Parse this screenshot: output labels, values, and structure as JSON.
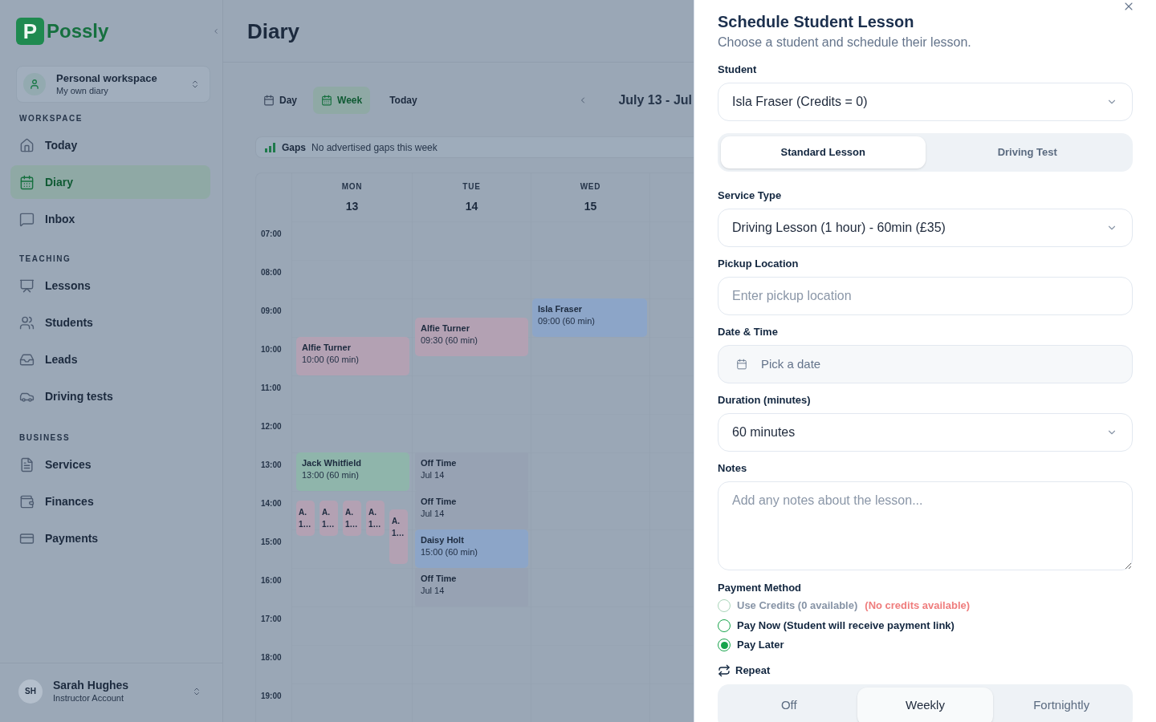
{
  "backdrop": {
    "sidebar": {
      "logo": {
        "mark": "P",
        "name": "Possly"
      },
      "workspace": {
        "title": "Personal workspace",
        "subtitle": "My own diary"
      },
      "sections": [
        {
          "title": "WORKSPACE",
          "items": [
            {
              "label": "Today",
              "selected": false
            },
            {
              "label": "Diary",
              "selected": true
            },
            {
              "label": "Inbox",
              "selected": false
            }
          ]
        },
        {
          "title": "TEACHING",
          "items": [
            {
              "label": "Lessons",
              "selected": false
            },
            {
              "label": "Students",
              "selected": false
            },
            {
              "label": "Leads",
              "selected": false
            },
            {
              "label": "Driving tests",
              "selected": false
            }
          ]
        },
        {
          "title": "BUSINESS",
          "items": [
            {
              "label": "Services",
              "selected": false
            },
            {
              "label": "Finances",
              "selected": false
            },
            {
              "label": "Payments",
              "selected": false
            }
          ]
        }
      ],
      "user": {
        "initials": "SH",
        "name": "Sarah Hughes",
        "role": "Instructor Account"
      }
    },
    "main": {
      "title": "Diary",
      "view_tabs": [
        {
          "label": "Day",
          "selected": false
        },
        {
          "label": "Week",
          "selected": true
        }
      ],
      "today_button": "Today",
      "date_range": "July 13 - Jul",
      "gaps": {
        "label": "Gaps",
        "text": "No advertised gaps this week"
      },
      "calendar": {
        "hours": [
          "07:00",
          "08:00",
          "09:00",
          "10:00",
          "11:00",
          "12:00",
          "13:00",
          "14:00",
          "15:00",
          "16:00",
          "17:00",
          "18:00",
          "19:00"
        ],
        "days": [
          {
            "weekday": "MON",
            "date": "13",
            "events": [
              {
                "kind": "lesson",
                "title": "Alfie Turner",
                "time": "10:00 (60 min)",
                "color": "#b3a1b3"
              },
              {
                "kind": "lesson",
                "title": "Jack Whitfield",
                "time": "13:00 (60 min)",
                "color": "#8fb5ab"
              },
              {
                "kind": "lesson",
                "title": "A.",
                "time": "1…",
                "color": "#b3a1b3"
              },
              {
                "kind": "lesson",
                "title": "A.",
                "time": "1…",
                "color": "#b3a1b3"
              },
              {
                "kind": "lesson",
                "title": "A.",
                "time": "1…",
                "color": "#b3a1b3"
              },
              {
                "kind": "lesson",
                "title": "A.",
                "time": "1…",
                "color": "#b3a1b3"
              },
              {
                "kind": "lesson",
                "title": "A.",
                "time": "1…",
                "color": "#b3a1b3"
              }
            ]
          },
          {
            "weekday": "TUE",
            "date": "14",
            "events": [
              {
                "kind": "lesson",
                "title": "Alfie Turner",
                "time": "09:30 (60 min)",
                "color": "#b3a1b3"
              },
              {
                "kind": "off_time",
                "title": "Off Time",
                "time": "Jul 14",
                "color": "#97a2b3"
              },
              {
                "kind": "off_time",
                "title": "Off Time",
                "time": "Jul 14",
                "color": "#97a2b3"
              },
              {
                "kind": "lesson",
                "title": "Daisy Holt",
                "time": "15:00 (60 min)",
                "color": "#8ca5c8"
              },
              {
                "kind": "off_time",
                "title": "Off Time",
                "time": "Jul 14",
                "color": "#97a2b3"
              }
            ]
          },
          {
            "weekday": "WED",
            "date": "15",
            "events": [
              {
                "kind": "lesson",
                "title": "Isla Fraser",
                "time": "09:00 (60 min)",
                "color": "#8ca5c8"
              }
            ]
          }
        ]
      }
    }
  },
  "dialog": {
    "title": "Schedule Student Lesson",
    "subtitle": "Choose a student and schedule their lesson.",
    "student": {
      "label": "Student",
      "value": "Isla Fraser (Credits = 0)"
    },
    "lesson_types": [
      {
        "label": "Standard Lesson",
        "selected": true
      },
      {
        "label": "Driving Test",
        "selected": false
      }
    ],
    "service_type": {
      "label": "Service Type",
      "value": "Driving Lesson (1 hour) - 60min (£35)"
    },
    "pickup_location": {
      "label": "Pickup Location",
      "placeholder": "Enter pickup location"
    },
    "date_time": {
      "label": "Date & Time",
      "placeholder": "Pick a date"
    },
    "duration": {
      "label": "Duration (minutes)",
      "value": "60 minutes"
    },
    "notes": {
      "label": "Notes",
      "placeholder": "Add any notes about the lesson..."
    },
    "payment_method": {
      "label": "Payment Method",
      "options": [
        {
          "label": "Use Credits (0 available)",
          "note": "(No credits available)",
          "selected": false,
          "disabled": true
        },
        {
          "label": "Pay Now (Student will receive payment link)",
          "selected": false,
          "disabled": false
        },
        {
          "label": "Pay Later",
          "selected": true,
          "disabled": false
        }
      ]
    },
    "repeat": {
      "label": "Repeat",
      "options": [
        {
          "label": "Off",
          "selected": false
        },
        {
          "label": "Weekly",
          "selected": true
        },
        {
          "label": "Fortnightly",
          "selected": false
        }
      ]
    }
  }
}
